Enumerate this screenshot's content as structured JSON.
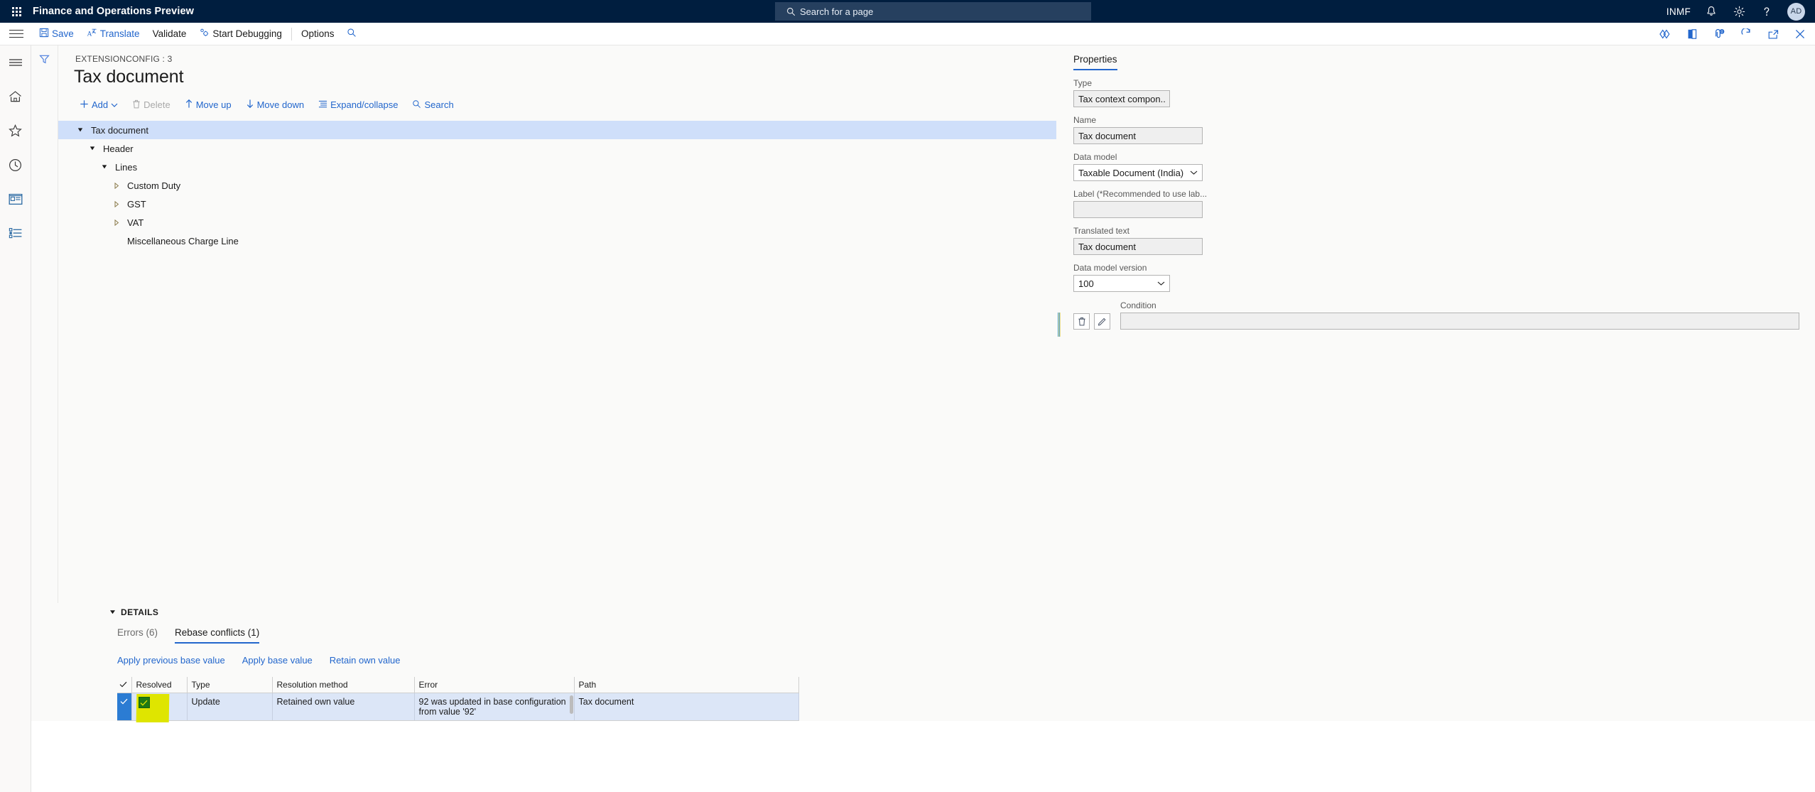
{
  "topbar": {
    "waffle_label": "app-launcher",
    "app_title": "Finance and Operations Preview",
    "search_placeholder": "Search for a page",
    "company": "INMF",
    "icons": [
      "notification-bell-icon",
      "gear-icon",
      "help-question-icon"
    ],
    "avatar_initials": "AD"
  },
  "commandbar": {
    "menu_label": "navigation-menu",
    "items": [
      {
        "label": "Save",
        "icon": "save-disk-icon",
        "style": "link"
      },
      {
        "label": "Translate",
        "icon": "translate-icon",
        "style": "link"
      },
      {
        "label": "Validate",
        "icon": "",
        "style": "dark"
      },
      {
        "label": "Start Debugging",
        "icon": "debug-gear-icon",
        "style": "dark"
      },
      {
        "label": "Options",
        "icon": "",
        "style": "dark"
      }
    ],
    "search_icon": "search-icon",
    "right_icons": [
      "diamond-personalize-icon",
      "open-in-office-icon",
      "attachments-icon",
      "refresh-icon",
      "popout-icon",
      "close-icon"
    ],
    "attachment_badge": "0"
  },
  "leftrail": {
    "items": [
      "hamburger-icon",
      "home-icon",
      "favorites-star-icon",
      "recent-clock-icon",
      "workspaces-icon",
      "modules-list-icon"
    ]
  },
  "main": {
    "filter_icon": "filter-icon",
    "breadcrumb": "EXTENSIONCONFIG : 3",
    "page_title": "Tax document",
    "toolbar": [
      {
        "label": "Add",
        "icon": "plus-icon",
        "has_caret": true,
        "disabled": false
      },
      {
        "label": "Delete",
        "icon": "trash-icon",
        "has_caret": false,
        "disabled": true
      },
      {
        "label": "Move up",
        "icon": "arrow-up-icon",
        "has_caret": false,
        "disabled": false
      },
      {
        "label": "Move down",
        "icon": "arrow-down-icon",
        "has_caret": false,
        "disabled": false
      },
      {
        "label": "Expand/collapse",
        "icon": "expand-collapse-icon",
        "has_caret": false,
        "disabled": false
      },
      {
        "label": "Search",
        "icon": "search-icon",
        "has_caret": false,
        "disabled": false
      }
    ],
    "tree": [
      {
        "label": "Tax document",
        "depth": 0,
        "state": "expanded",
        "selected": true
      },
      {
        "label": "Header",
        "depth": 1,
        "state": "expanded",
        "selected": false
      },
      {
        "label": "Lines",
        "depth": 2,
        "state": "expanded",
        "selected": false
      },
      {
        "label": "Custom Duty",
        "depth": 3,
        "state": "collapsed",
        "selected": false
      },
      {
        "label": "GST",
        "depth": 3,
        "state": "collapsed",
        "selected": false
      },
      {
        "label": "VAT",
        "depth": 3,
        "state": "collapsed",
        "selected": false
      },
      {
        "label": "Miscellaneous Charge Line",
        "depth": 3,
        "state": "leaf",
        "selected": false
      }
    ]
  },
  "properties": {
    "tab_label": "Properties",
    "fields": {
      "type_label": "Type",
      "type_value": "Tax context compon...",
      "name_label": "Name",
      "name_value": "Tax document",
      "data_model_label": "Data model",
      "data_model_value": "Taxable Document (India)",
      "label_label": "Label (*Recommended to use lab...",
      "label_value": "",
      "translated_label": "Translated text",
      "translated_value": "Tax document",
      "version_label": "Data model version",
      "version_value": "100",
      "condition_label": "Condition",
      "condition_value": ""
    },
    "buttons": [
      {
        "name": "delete-condition-button",
        "icon": "trash-icon"
      },
      {
        "name": "edit-condition-button",
        "icon": "pencil-icon"
      }
    ]
  },
  "details": {
    "section_title": "DETAILS",
    "collapse_icon": "triangle-down-icon",
    "tabs": [
      {
        "label": "Errors (6)",
        "active": false
      },
      {
        "label": "Rebase conflicts (1)",
        "active": true
      }
    ],
    "actions": [
      "Apply previous base value",
      "Apply base value",
      "Retain own value"
    ],
    "grid": {
      "columns": [
        "",
        "Resolved",
        "Type",
        "Resolution method",
        "Error",
        "Path"
      ],
      "header_check_icon": "checkmark-icon",
      "rows": [
        {
          "selected": true,
          "resolved_checked": true,
          "resolved_highlighted": true,
          "type": "Update",
          "resolution_method": "Retained own value",
          "error": "92 was updated in base configuration from value '92'",
          "path": "Tax document"
        }
      ]
    }
  },
  "colors": {
    "nav_bg": "#001e3f",
    "accent": "#2266cc",
    "selection": "#cfdffa",
    "row_selection": "#dce6f7",
    "highlight_yellow": "#dfe500",
    "checkbox_green": "#1e7a14",
    "select_marker_blue": "#2b7cd3"
  }
}
